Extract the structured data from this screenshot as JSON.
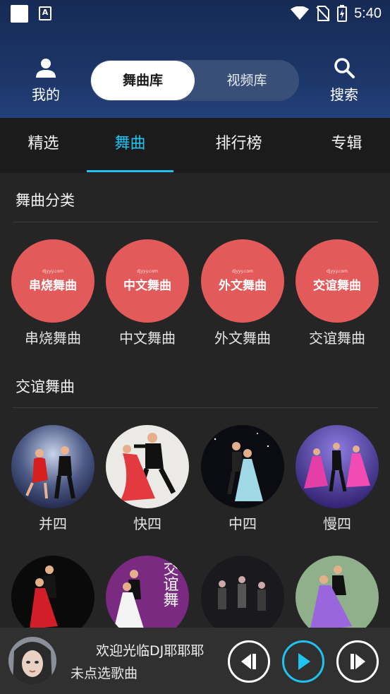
{
  "status_bar": {
    "time": "5:40",
    "notif_icon_text": "A"
  },
  "header": {
    "mine_label": "我的",
    "search_label": "搜索",
    "segment": {
      "active": "舞曲库",
      "inactive": "视频库"
    }
  },
  "tabs": [
    "精选",
    "舞曲",
    "排行榜",
    "专辑"
  ],
  "categories": {
    "title": "舞曲分类",
    "watermark": "djyyy.com",
    "items": [
      {
        "badge": "串烧舞曲",
        "label": "串烧舞曲"
      },
      {
        "badge": "中文舞曲",
        "label": "中文舞曲"
      },
      {
        "badge": "外文舞曲",
        "label": "外文舞曲"
      },
      {
        "badge": "交谊舞曲",
        "label": "交谊舞曲"
      }
    ]
  },
  "ballroom": {
    "title": "交谊舞曲",
    "items": [
      {
        "label": "并四"
      },
      {
        "label": "快四"
      },
      {
        "label": "中四"
      },
      {
        "label": "慢四"
      }
    ],
    "poster_text": "交谊舞"
  },
  "player": {
    "title": "欢迎光临DJ耶耶耶",
    "subtitle": "未点选歌曲"
  },
  "colors": {
    "accent": "#1ec3f0",
    "category_red": "#e35a5a",
    "header_blue": "#1c3566"
  }
}
